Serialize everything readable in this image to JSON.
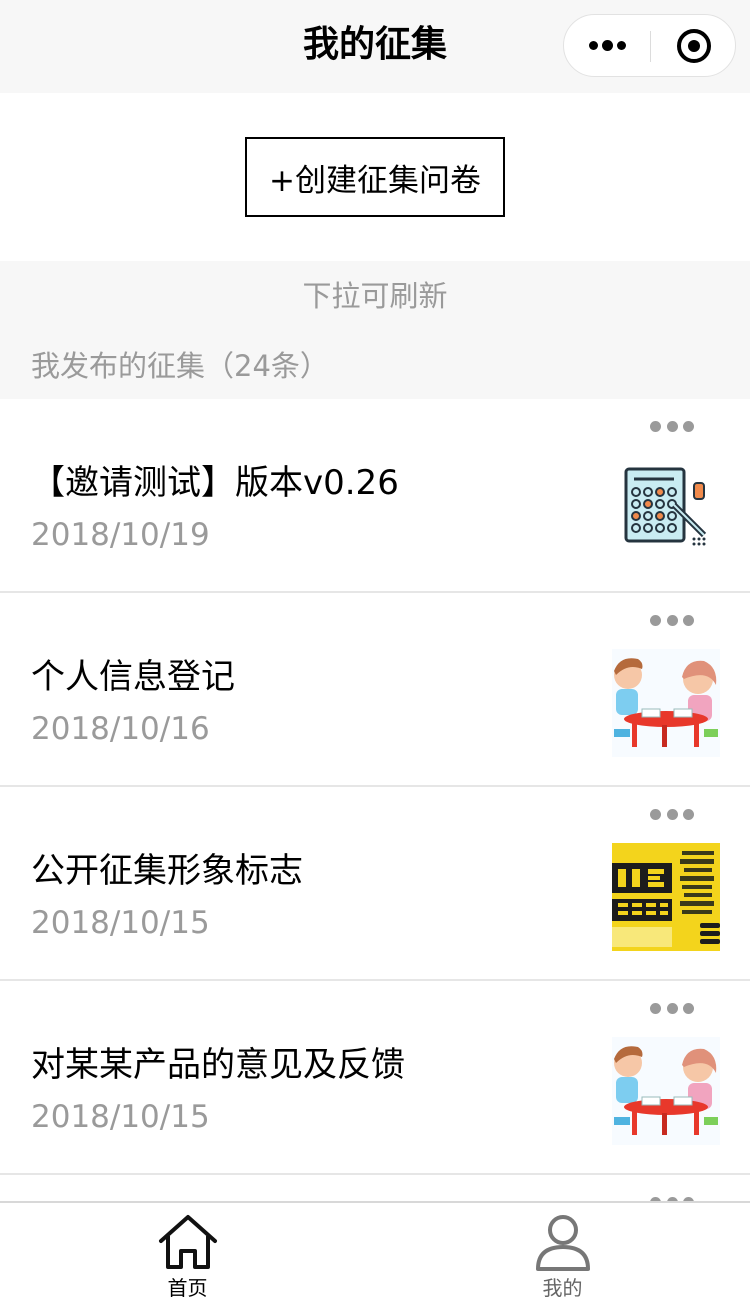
{
  "nav": {
    "title": "我的征集",
    "more_icon": "more-dots-icon",
    "close_icon": "target-close-icon"
  },
  "create_button_label": "+创建征集问卷",
  "pull_hint": "下拉可刷新",
  "section_title": "我发布的征集（24条）",
  "items": [
    {
      "title": "【邀请测试】版本v0.26",
      "date": "2018/10/19",
      "thumbnail": "calculator-illustration"
    },
    {
      "title": "个人信息登记",
      "date": "2018/10/16",
      "thumbnail": "kids-at-table-illustration"
    },
    {
      "title": "公开征集形象标志",
      "date": "2018/10/15",
      "thumbnail": "we-need-you-ideas-poster"
    },
    {
      "title": "对某某产品的意见及反馈",
      "date": "2018/10/15",
      "thumbnail": "kids-at-table-illustration"
    }
  ],
  "tabs": [
    {
      "label": "首页",
      "icon": "home-icon",
      "active": true
    },
    {
      "label": "我的",
      "icon": "user-icon",
      "active": false
    }
  ],
  "colors": {
    "nav_bg": "#f7f7f7",
    "secondary_text": "#9a9a9a",
    "divider": "#e6e6e6"
  }
}
